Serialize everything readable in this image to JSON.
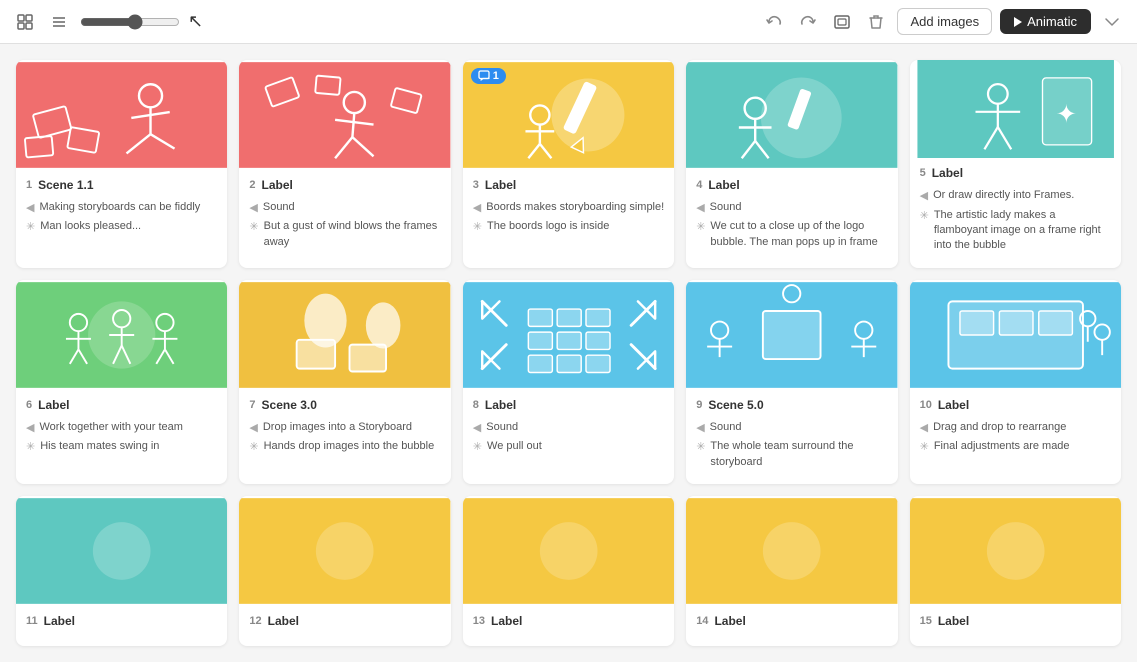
{
  "toolbar": {
    "undo_label": "Undo",
    "redo_label": "Redo",
    "add_images_label": "Add images",
    "animatic_label": "Animatic",
    "zoom_value": 60
  },
  "cards": [
    {
      "number": "1",
      "scene": "Scene 1.1",
      "bg": "coral",
      "sound_label": "",
      "action_label": "",
      "lines": [
        {
          "type": "sound",
          "text": "Making storyboards can be fiddly"
        },
        {
          "type": "action",
          "text": "Man looks pleased..."
        }
      ],
      "comment_count": null
    },
    {
      "number": "2",
      "scene": "Label",
      "bg": "coral",
      "lines": [
        {
          "type": "sound",
          "text": "Sound"
        },
        {
          "type": "action",
          "text": "But a gust of wind blows the frames away"
        }
      ],
      "comment_count": null
    },
    {
      "number": "3",
      "scene": "Label",
      "bg": "yellow",
      "lines": [
        {
          "type": "sound",
          "text": "Boords makes storyboarding simple!"
        },
        {
          "type": "action",
          "text": "The boords logo is inside"
        }
      ],
      "comment_count": 1
    },
    {
      "number": "4",
      "scene": "Label",
      "bg": "teal",
      "lines": [
        {
          "type": "sound",
          "text": "Sound"
        },
        {
          "type": "action",
          "text": "We cut to a close up of the logo bubble. The man pops up in frame"
        }
      ],
      "comment_count": null
    },
    {
      "number": "5",
      "scene": "Label",
      "bg": "teal",
      "lines": [
        {
          "type": "sound",
          "text": "Or draw directly into Frames."
        },
        {
          "type": "action",
          "text": "The artistic lady makes a flamboyant image on a frame right into the bubble"
        }
      ],
      "comment_count": null
    },
    {
      "number": "6",
      "scene": "Label",
      "bg": "green",
      "lines": [
        {
          "type": "sound",
          "text": "Work together with your team"
        },
        {
          "type": "action",
          "text": "His team mates swing in"
        }
      ],
      "comment_count": null
    },
    {
      "number": "7",
      "scene": "Scene 3.0",
      "bg": "yellow-warm",
      "lines": [
        {
          "type": "sound",
          "text": "Drop images into a Storyboard"
        },
        {
          "type": "action",
          "text": "Hands drop images into the bubble"
        }
      ],
      "comment_count": null
    },
    {
      "number": "8",
      "scene": "Label",
      "bg": "blue-light",
      "lines": [
        {
          "type": "sound",
          "text": "Sound"
        },
        {
          "type": "action",
          "text": "We pull out"
        }
      ],
      "comment_count": null
    },
    {
      "number": "9",
      "scene": "Scene 5.0",
      "bg": "blue-light",
      "lines": [
        {
          "type": "sound",
          "text": "Sound"
        },
        {
          "type": "action",
          "text": "The whole team surround the storyboard"
        }
      ],
      "comment_count": null
    },
    {
      "number": "10",
      "scene": "Label",
      "bg": "blue-light",
      "lines": [
        {
          "type": "sound",
          "text": "Drag and drop to rearrange"
        },
        {
          "type": "action",
          "text": "Final adjustments are made"
        }
      ],
      "comment_count": null
    },
    {
      "number": "11",
      "scene": "Label",
      "bg": "teal",
      "lines": [],
      "comment_count": null
    },
    {
      "number": "12",
      "scene": "Label",
      "bg": "yellow",
      "lines": [],
      "comment_count": null
    },
    {
      "number": "13",
      "scene": "Label",
      "bg": "yellow",
      "lines": [],
      "comment_count": null
    },
    {
      "number": "14",
      "scene": "Label",
      "bg": "yellow",
      "lines": [],
      "comment_count": null
    },
    {
      "number": "15",
      "scene": "Label",
      "bg": "yellow",
      "lines": [],
      "comment_count": null
    }
  ]
}
